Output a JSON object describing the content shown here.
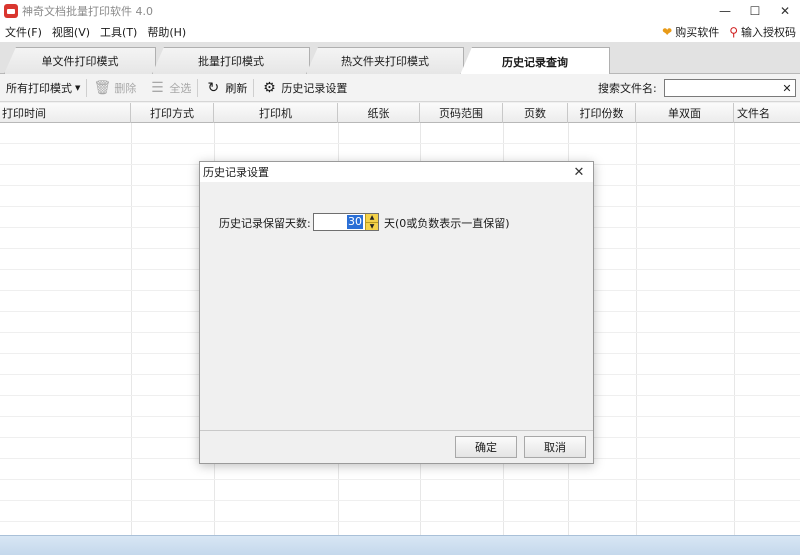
{
  "window": {
    "title": "神奇文档批量打印软件 4.0"
  },
  "menu": {
    "items": [
      "文件(F)",
      "视图(V)",
      "工具(T)",
      "帮助(H)"
    ],
    "buy": "购买软件",
    "license": "输入授权码"
  },
  "tabs": [
    {
      "label": "单文件打印模式"
    },
    {
      "label": "批量打印模式"
    },
    {
      "label": "热文件夹打印模式"
    },
    {
      "label": "历史记录查询"
    }
  ],
  "toolbar": {
    "filter": "所有打印模式",
    "delete": "删除",
    "select_all": "全选",
    "refresh": "刷新",
    "history_settings": "历史记录设置",
    "search_label": "搜索文件名:",
    "search_value": ""
  },
  "grid": {
    "columns": [
      "打印时间",
      "打印方式",
      "打印机",
      "纸张",
      "页码范围",
      "页数",
      "打印份数",
      "单双面",
      "文件名"
    ]
  },
  "dialog": {
    "title": "历史记录设置",
    "label": "历史记录保留天数:",
    "days": "30",
    "hint": "天(0或负数表示一直保留)",
    "ok": "确定",
    "cancel": "取消"
  }
}
